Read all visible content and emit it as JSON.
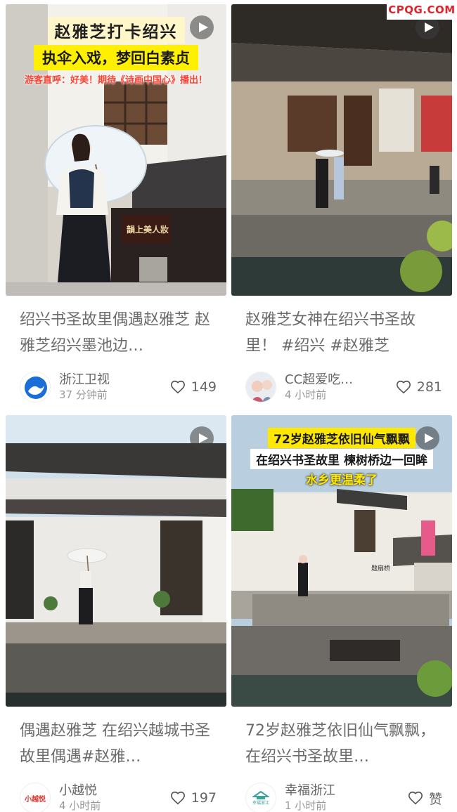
{
  "watermark": "CPQG.COM",
  "cards": [
    {
      "overlay": {
        "line1": "赵雅芝打卡绍兴",
        "line2": "执伞入戏，梦回白素贞",
        "line3": "游客直呼：好美！期待《诗画中国心》播出！"
      },
      "sign": "韻上美人妝",
      "title": "绍兴书圣故里偶遇赵雅芝 赵雅芝绍兴墨池边…",
      "author": "浙江卫视",
      "time": "37 分钟前",
      "likes": "149"
    },
    {
      "title": "赵雅芝女神在绍兴书圣故里！ #绍兴 #赵雅芝",
      "author": "CC超爱吃…",
      "time": "4 小时前",
      "likes": "281"
    },
    {
      "title": "偶遇赵雅芝 在绍兴越城书圣故里偶遇#赵雅…",
      "author": "小越悦",
      "avatar_text": "小越悦",
      "time": "4 小时前",
      "likes": "197"
    },
    {
      "overlay": {
        "line1": "72岁赵雅芝依旧仙气飘飘",
        "line2": "在绍兴书圣故里 楝树桥边一回眸",
        "line3": "水乡更温柔了"
      },
      "sign": "题扇桥",
      "title": "72岁赵雅芝依旧仙气飘飘，在绍兴书圣故里…",
      "author": "幸福浙江",
      "avatar_text": "幸福浙江",
      "time": "1 小时前",
      "likes": "赞"
    }
  ],
  "icons": {
    "play": "play-icon",
    "like": "heart-outline-icon"
  },
  "colors": {
    "watermark": "#e0242b",
    "title_text": "#6b6b6b",
    "meta_text": "#9a9a9a",
    "overlay_yellow": "#fff000"
  }
}
